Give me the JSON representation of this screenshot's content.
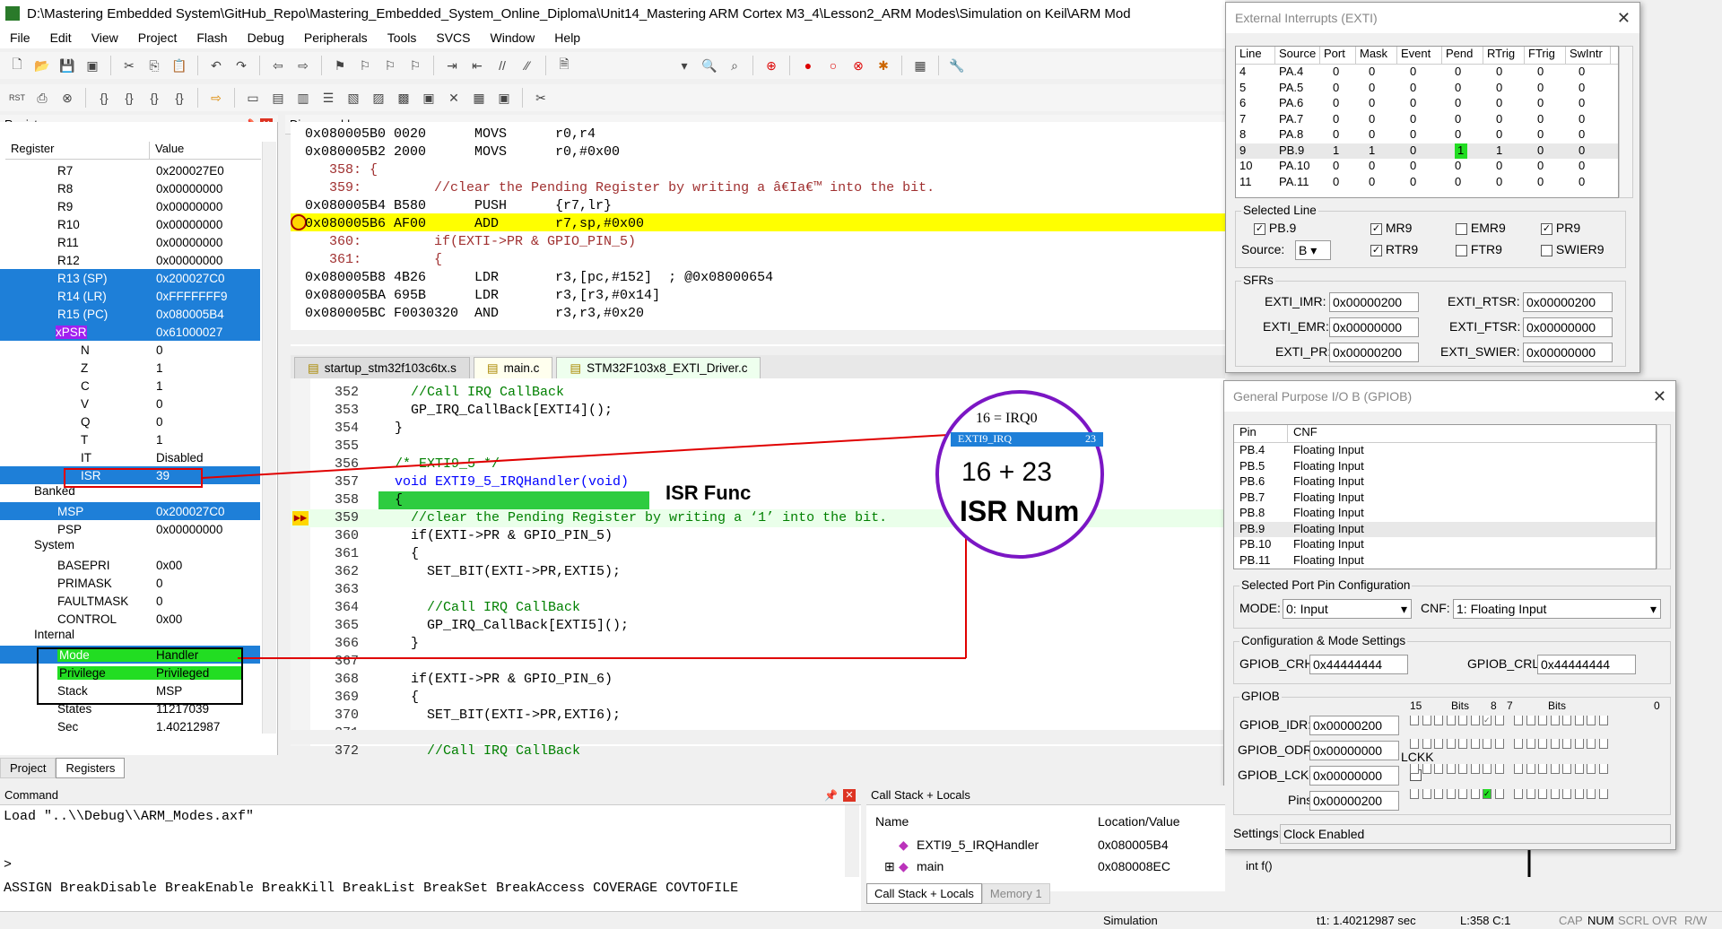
{
  "window": {
    "title": "D:\\Mastering Embedded System\\GitHub_Repo\\Mastering_Embedded_System_Online_Diploma\\Unit14_Mastering ARM Cortex M3_4\\Lesson2_ARM Modes\\Simulation on Keil\\ARM Mod"
  },
  "menu": [
    "File",
    "Edit",
    "View",
    "Project",
    "Flash",
    "Debug",
    "Peripherals",
    "Tools",
    "SVCS",
    "Window",
    "Help"
  ],
  "registers": {
    "title": "Registers",
    "col_register": "Register",
    "col_value": "Value",
    "rows": [
      {
        "name": "R7",
        "value": "0x200027E0"
      },
      {
        "name": "R8",
        "value": "0x00000000"
      },
      {
        "name": "R9",
        "value": "0x00000000"
      },
      {
        "name": "R10",
        "value": "0x00000000"
      },
      {
        "name": "R11",
        "value": "0x00000000"
      },
      {
        "name": "R12",
        "value": "0x00000000"
      },
      {
        "name": "R13 (SP)",
        "value": "0x200027C0"
      },
      {
        "name": "R14 (LR)",
        "value": "0xFFFFFFF9"
      },
      {
        "name": "R15 (PC)",
        "value": "0x080005B4"
      },
      {
        "name": "xPSR",
        "value": "0x61000027"
      },
      {
        "name": "N",
        "value": "0"
      },
      {
        "name": "Z",
        "value": "1"
      },
      {
        "name": "C",
        "value": "1"
      },
      {
        "name": "V",
        "value": "0"
      },
      {
        "name": "Q",
        "value": "0"
      },
      {
        "name": "T",
        "value": "1"
      },
      {
        "name": "IT",
        "value": "Disabled"
      },
      {
        "name": "ISR",
        "value": "39"
      }
    ],
    "banked_label": "Banked",
    "banked": [
      {
        "name": "MSP",
        "value": "0x200027C0"
      },
      {
        "name": "PSP",
        "value": "0x00000000"
      }
    ],
    "system_label": "System",
    "system": [
      {
        "name": "BASEPRI",
        "value": "0x00"
      },
      {
        "name": "PRIMASK",
        "value": "0"
      },
      {
        "name": "FAULTMASK",
        "value": "0"
      },
      {
        "name": "CONTROL",
        "value": "0x00"
      }
    ],
    "internal_label": "Internal",
    "internal": [
      {
        "name": "Mode",
        "value": "Handler"
      },
      {
        "name": "Privilege",
        "value": "Privileged"
      },
      {
        "name": "Stack",
        "value": "MSP"
      },
      {
        "name": "States",
        "value": "11217039"
      },
      {
        "name": "Sec",
        "value": "1.40212987"
      }
    ],
    "tab_project": "Project",
    "tab_registers": "Registers"
  },
  "disasm": {
    "title": "Disassembly",
    "lines": [
      "0x080005B0 0020      MOVS      r0,r4",
      "0x080005B2 2000      MOVS      r0,#0x00",
      "   358: {",
      "   359:         //clear the Pending Register by writing a â€Ia€™ into the bit.",
      "0x080005B4 B580      PUSH      {r7,lr}",
      "0x080005B6 AF00      ADD       r7,sp,#0x00",
      "   360:         if(EXTI->PR & GPIO_PIN_5)",
      "   361:         {",
      "0x080005B8 4B26      LDR       r3,[pc,#152]  ; @0x08000654",
      "0x080005BA 695B      LDR       r3,[r3,#0x14]",
      "0x080005BC F0030320  AND       r3,r3,#0x20"
    ]
  },
  "tabs": [
    "startup_stm32f103c6tx.s",
    "main.c",
    "STM32F103x8_EXTI_Driver.c"
  ],
  "editor": {
    "lines": [
      {
        "n": "352",
        "t": "    //Call IRQ CallBack",
        "c": "cm"
      },
      {
        "n": "353",
        "t": "    GP_IRQ_CallBack[EXTI4]();",
        "c": ""
      },
      {
        "n": "354",
        "t": "  }",
        "c": ""
      },
      {
        "n": "355",
        "t": "",
        "c": ""
      },
      {
        "n": "356",
        "t": "  /* EXTI9_5 */",
        "c": "cm"
      },
      {
        "n": "357",
        "t": "  void EXTI9_5_IRQHandler(void)",
        "c": "kw"
      },
      {
        "n": "358",
        "t": "  {",
        "c": ""
      },
      {
        "n": "359",
        "t": "    //clear the Pending Register by writing a ‘1’ into the bit.",
        "c": "cm"
      },
      {
        "n": "360",
        "t": "    if(EXTI->PR & GPIO_PIN_5)",
        "c": ""
      },
      {
        "n": "361",
        "t": "    {",
        "c": ""
      },
      {
        "n": "362",
        "t": "      SET_BIT(EXTI->PR,EXTI5);",
        "c": ""
      },
      {
        "n": "363",
        "t": "",
        "c": ""
      },
      {
        "n": "364",
        "t": "      //Call IRQ CallBack",
        "c": "cm"
      },
      {
        "n": "365",
        "t": "      GP_IRQ_CallBack[EXTI5]();",
        "c": ""
      },
      {
        "n": "366",
        "t": "    }",
        "c": ""
      },
      {
        "n": "367",
        "t": "",
        "c": ""
      },
      {
        "n": "368",
        "t": "    if(EXTI->PR & GPIO_PIN_6)",
        "c": ""
      },
      {
        "n": "369",
        "t": "    {",
        "c": ""
      },
      {
        "n": "370",
        "t": "      SET_BIT(EXTI->PR,EXTI6);",
        "c": ""
      },
      {
        "n": "371",
        "t": "",
        "c": ""
      },
      {
        "n": "372",
        "t": "      //Call IRQ CallBack",
        "c": "cm"
      }
    ]
  },
  "annotations": {
    "isr_func": "ISR Func",
    "irq0": "16 = IRQ0",
    "irq_name": "EXTI9_IRQ",
    "irq_num": "23",
    "sum": "16 + 23",
    "isr_num": "ISR Num"
  },
  "exti": {
    "title": "External Interrupts (EXTI)",
    "cols": [
      "Line",
      "Source",
      "Port",
      "Mask",
      "Event",
      "Pend",
      "RTrig",
      "FTrig",
      "SwIntr"
    ],
    "rows": [
      [
        "4",
        "PA.4",
        "0",
        "0",
        "0",
        "0",
        "0",
        "0",
        "0"
      ],
      [
        "5",
        "PA.5",
        "0",
        "0",
        "0",
        "0",
        "0",
        "0",
        "0"
      ],
      [
        "6",
        "PA.6",
        "0",
        "0",
        "0",
        "0",
        "0",
        "0",
        "0"
      ],
      [
        "7",
        "PA.7",
        "0",
        "0",
        "0",
        "0",
        "0",
        "0",
        "0"
      ],
      [
        "8",
        "PA.8",
        "0",
        "0",
        "0",
        "0",
        "0",
        "0",
        "0"
      ],
      [
        "9",
        "PB.9",
        "1",
        "1",
        "0",
        "1",
        "1",
        "0",
        "0"
      ],
      [
        "10",
        "PA.10",
        "0",
        "0",
        "0",
        "0",
        "0",
        "0",
        "0"
      ],
      [
        "11",
        "PA.11",
        "0",
        "0",
        "0",
        "0",
        "0",
        "0",
        "0"
      ]
    ],
    "selected_line": "Selected Line",
    "pb9": "PB.9",
    "mr9": "MR9",
    "emr9": "EMR9",
    "pr9": "PR9",
    "source_label": "Source:",
    "source": "B",
    "rtr9": "RTR9",
    "ftr9": "FTR9",
    "swier9": "SWIER9",
    "sfrs": "SFRs",
    "imr_l": "EXTI_IMR:",
    "imr": "0x00000200",
    "rtsr_l": "EXTI_RTSR:",
    "rtsr": "0x00000200",
    "emr_l": "EXTI_EMR:",
    "emr": "0x00000000",
    "ftsr_l": "EXTI_FTSR:",
    "ftsr": "0x00000000",
    "pr_l": "EXTI_PR:",
    "pr": "0x00000200",
    "swier_l": "EXTI_SWIER:",
    "swier": "0x00000000"
  },
  "gpio": {
    "title": "General Purpose I/O B (GPIOB)",
    "col_pin": "Pin",
    "col_cnf": "CNF",
    "rows": [
      [
        "PB.4",
        "Floating Input"
      ],
      [
        "PB.5",
        "Floating Input"
      ],
      [
        "PB.6",
        "Floating Input"
      ],
      [
        "PB.7",
        "Floating Input"
      ],
      [
        "PB.8",
        "Floating Input"
      ],
      [
        "PB.9",
        "Floating Input"
      ],
      [
        "PB.10",
        "Floating Input"
      ],
      [
        "PB.11",
        "Floating Input"
      ]
    ],
    "spc": "Selected Port Pin Configuration",
    "mode_l": "MODE:",
    "mode": "0: Input",
    "cnf_l": "CNF:",
    "cnf": "1: Floating Input",
    "cms": "Configuration & Mode Settings",
    "crh_l": "GPIOB_CRH:",
    "crh": "0x44444444",
    "crl_l": "GPIOB_CRL:",
    "crl": "0x44444444",
    "gpiob": "GPIOB",
    "b15": "15",
    "bits1": "Bits",
    "b8": "8",
    "b7": "7",
    "bits2": "Bits",
    "b0": "0",
    "idr_l": "GPIOB_IDR:",
    "idr": "0x00000200",
    "odr_l": "GPIOB_ODR:",
    "odr": "0x00000000",
    "lckk": "LCKK",
    "lckr_l": "GPIOB_LCKR:",
    "lckr": "0x00000000",
    "pins_l": "Pins:",
    "pins": "0x00000200",
    "settings_l": "Settings:",
    "settings": "Clock Enabled"
  },
  "command": {
    "title": "Command",
    "line1": "Load \"..\\\\Debug\\\\ARM_Modes.axf\"",
    "prompt": ">",
    "hints": "ASSIGN BreakDisable BreakEnable BreakKill BreakList BreakSet BreakAccess COVERAGE COVTOFILE"
  },
  "callstack": {
    "title": "Call Stack + Locals",
    "col_name": "Name",
    "col_loc": "Location/Value",
    "rows": [
      {
        "name": "EXTI9_5_IRQHandler",
        "loc": "0x080005B4"
      },
      {
        "name": "main",
        "loc": "0x080008EC"
      }
    ],
    "extra": "int f()",
    "tab1": "Call Stack + Locals",
    "tab2": "Memory 1"
  },
  "status": {
    "mode": "Simulation",
    "t1": "t1: 1.40212987 sec",
    "pos": "L:358 C:1",
    "caps": "CAP",
    "num": "NUM",
    "scrl": "SCRL",
    "ovr": "OVR",
    "rw": "R/W"
  },
  "colors": {
    "highlight_yellow": "#ffff00",
    "selection_blue": "#1e7fd8",
    "annotation_red": "#e00000",
    "circle_purple": "#7b16c4",
    "green": "#22dd22"
  }
}
